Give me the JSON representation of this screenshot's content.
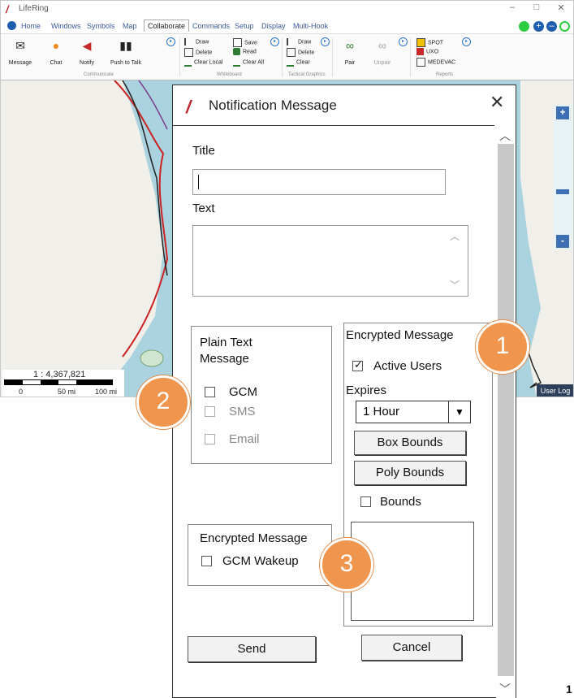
{
  "app": {
    "title": "LifeRing",
    "menu": [
      "Home",
      "Windows",
      "Symbols",
      "Map",
      "Collaborate",
      "Commands",
      "Setup",
      "Display",
      "Multi-Hook"
    ],
    "active_menu": "Collaborate"
  },
  "ribbon": {
    "communicate": {
      "label": "Communicate",
      "buttons": [
        "Message",
        "Chat",
        "Notify",
        "Push to Talk"
      ]
    },
    "whiteboard": {
      "label": "Whiteboard",
      "col1": [
        "Draw",
        "Delete",
        "Clear Local"
      ],
      "col2": [
        "Save",
        "Read",
        "Clear All"
      ]
    },
    "tactical": {
      "label": "Tactical Graphics",
      "items": [
        "Draw",
        "Delete",
        "Clear"
      ]
    },
    "pairing": {
      "buttons": [
        "Pair",
        "Unpair"
      ]
    },
    "reports": {
      "label": "Reports",
      "items": [
        "SPOT",
        "UXO",
        "MEDEVAC"
      ]
    }
  },
  "map": {
    "scale_ratio": "1 : 4,367,821",
    "scale_ticks": [
      "0",
      "50 mi",
      "100 mi"
    ],
    "user_log": "User Log",
    "zoom_in": "+",
    "zoom_out": "-"
  },
  "dialog": {
    "title": "Notification Message",
    "title_label": "Title",
    "title_value": "",
    "text_label": "Text",
    "text_value": "",
    "plain": {
      "label": "Plain Text Message",
      "options": [
        {
          "label": "GCM",
          "checked": false,
          "enabled": true
        },
        {
          "label": "SMS",
          "checked": false,
          "enabled": false
        },
        {
          "label": "Email",
          "checked": false,
          "enabled": false
        }
      ]
    },
    "encrypted_right": {
      "label": "Encrypted Message",
      "active_users": "Active Users",
      "active_users_checked": true,
      "expires_label": "Expires",
      "expires_value": "1 Hour",
      "box_bounds": "Box Bounds",
      "poly_bounds": "Poly Bounds",
      "bounds": "Bounds"
    },
    "encrypted_left": {
      "label": "Encrypted Message",
      "gcm_wakeup": "GCM Wakeup"
    },
    "send": "Send",
    "cancel": "Cancel"
  },
  "callouts": [
    "1",
    "2",
    "3"
  ],
  "page_number": "1",
  "colors": {
    "badge": "#f0954d",
    "accent": "#2b74c9",
    "status_green": "#2ecc40"
  }
}
